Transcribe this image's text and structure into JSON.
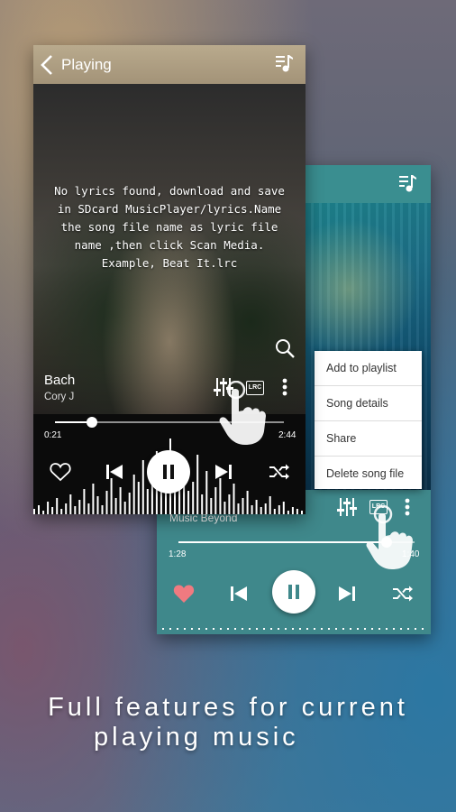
{
  "front_player": {
    "header_title": "Playing",
    "lyrics_message": "No lyrics found, download and save\nin SDcard MusicPlayer/lyrics.Name\nthe song file name as lyric file\nname ,then click Scan Media.\nExample, Beat It.lrc",
    "song_title": "Bach",
    "artist": "Cory J",
    "elapsed": "0:21",
    "duration": "2:44",
    "progress": 0.16,
    "lrc_label": "LRC"
  },
  "back_player": {
    "song_title": "Music Beyond",
    "elapsed": "1:28",
    "duration": "1:40",
    "progress": 0.88,
    "lrc_label": "LRC",
    "accent": "#3f888b"
  },
  "context_menu": {
    "items": [
      "Add to playlist",
      "Song details",
      "Share",
      "Delete song file"
    ]
  },
  "caption": {
    "line1": "Full features for current",
    "line2": "playing music"
  },
  "icons": [
    "chevron-left-icon",
    "playlist-icon",
    "search-icon",
    "equalizer-icon",
    "lrc-icon",
    "more-vert-icon",
    "heart-icon",
    "skip-previous-icon",
    "pause-icon",
    "skip-next-icon",
    "shuffle-icon",
    "hand-pointer-icon"
  ],
  "colors": {
    "heart_active": "#f07a80",
    "teal": "#3f888b",
    "header_tan": "#b0a083"
  }
}
